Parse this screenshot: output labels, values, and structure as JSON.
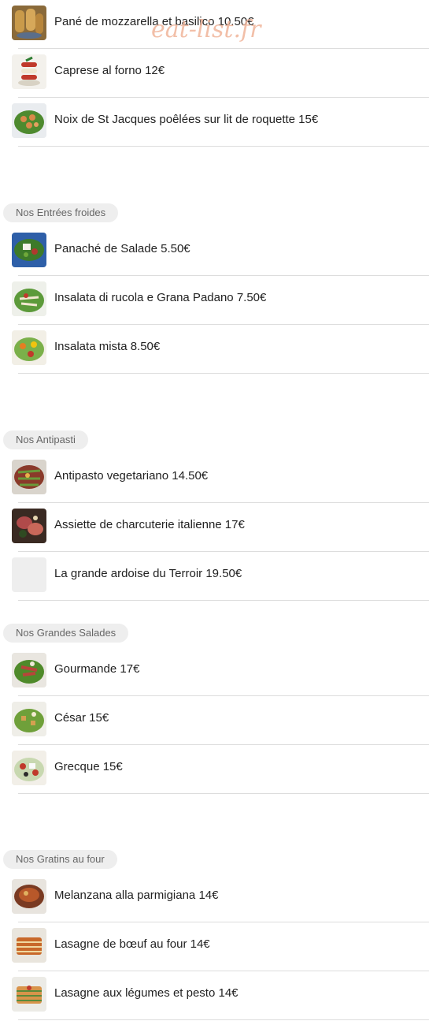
{
  "watermark": "eat-list.fr",
  "sections": {
    "0": {
      "items": [
        {
          "label": "Pané de mozzarella et basilico 10.50€",
          "icon": "food-photo-icon"
        },
        {
          "label": "Caprese al forno 12€",
          "icon": "food-photo-icon"
        },
        {
          "label": "Noix de St Jacques poêlées sur lit de roquette 15€",
          "icon": "food-photo-icon"
        }
      ]
    },
    "1": {
      "title": "Nos Entrées froides",
      "items": [
        {
          "label": "Panaché de Salade 5.50€",
          "icon": "food-photo-icon"
        },
        {
          "label": "Insalata di rucola e Grana Padano 7.50€",
          "icon": "food-photo-icon"
        },
        {
          "label": "Insalata mista 8.50€",
          "icon": "food-photo-icon"
        }
      ]
    },
    "2": {
      "title": "Nos Antipasti",
      "items": [
        {
          "label": "Antipasto vegetariano 14.50€",
          "icon": "food-photo-icon"
        },
        {
          "label": "Assiette de charcuterie italienne 17€",
          "icon": "food-photo-icon"
        },
        {
          "label": "La grande ardoise du Terroir 19.50€",
          "icon": "placeholder-icon"
        }
      ]
    },
    "3": {
      "title": "Nos Grandes Salades",
      "items": [
        {
          "label": "Gourmande 17€",
          "icon": "food-photo-icon"
        },
        {
          "label": "César 15€",
          "icon": "food-photo-icon"
        },
        {
          "label": "Grecque 15€",
          "icon": "food-photo-icon"
        }
      ]
    },
    "4": {
      "title": "Nos Gratins au four",
      "items": [
        {
          "label": "Melanzana alla parmigiana 14€",
          "icon": "food-photo-icon"
        },
        {
          "label": "Lasagne de bœuf au four 14€",
          "icon": "food-photo-icon"
        },
        {
          "label": "Lasagne aux légumes et pesto 14€",
          "icon": "food-photo-icon"
        }
      ]
    }
  }
}
